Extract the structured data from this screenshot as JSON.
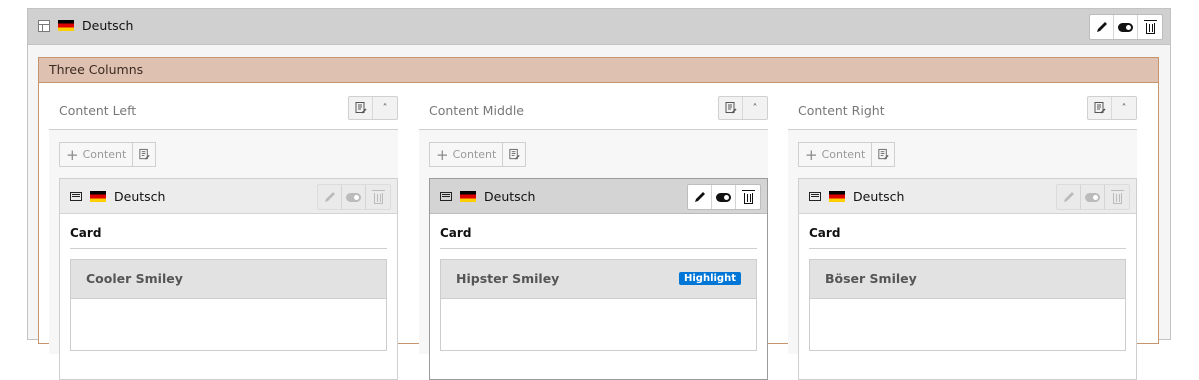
{
  "page_header": {
    "language": "Deutsch"
  },
  "grid_element": {
    "title": "Three Columns"
  },
  "columns": [
    {
      "title": "Content Left",
      "new_content_label": "Content",
      "element": {
        "language": "Deutsch",
        "content_type": "Card",
        "card_title": "Cooler Smiley",
        "badge": null,
        "active": false
      }
    },
    {
      "title": "Content Middle",
      "new_content_label": "Content",
      "element": {
        "language": "Deutsch",
        "content_type": "Card",
        "card_title": "Hipster Smiley",
        "badge": "Highlight",
        "active": true
      }
    },
    {
      "title": "Content Right",
      "new_content_label": "Content",
      "element": {
        "language": "Deutsch",
        "content_type": "Card",
        "card_title": "Böser Smiley",
        "badge": null,
        "active": false
      }
    }
  ],
  "colors": {
    "accent": "#0076d6",
    "grid_header_bg": "#dfc1b1",
    "grid_border": "#c5956f"
  }
}
